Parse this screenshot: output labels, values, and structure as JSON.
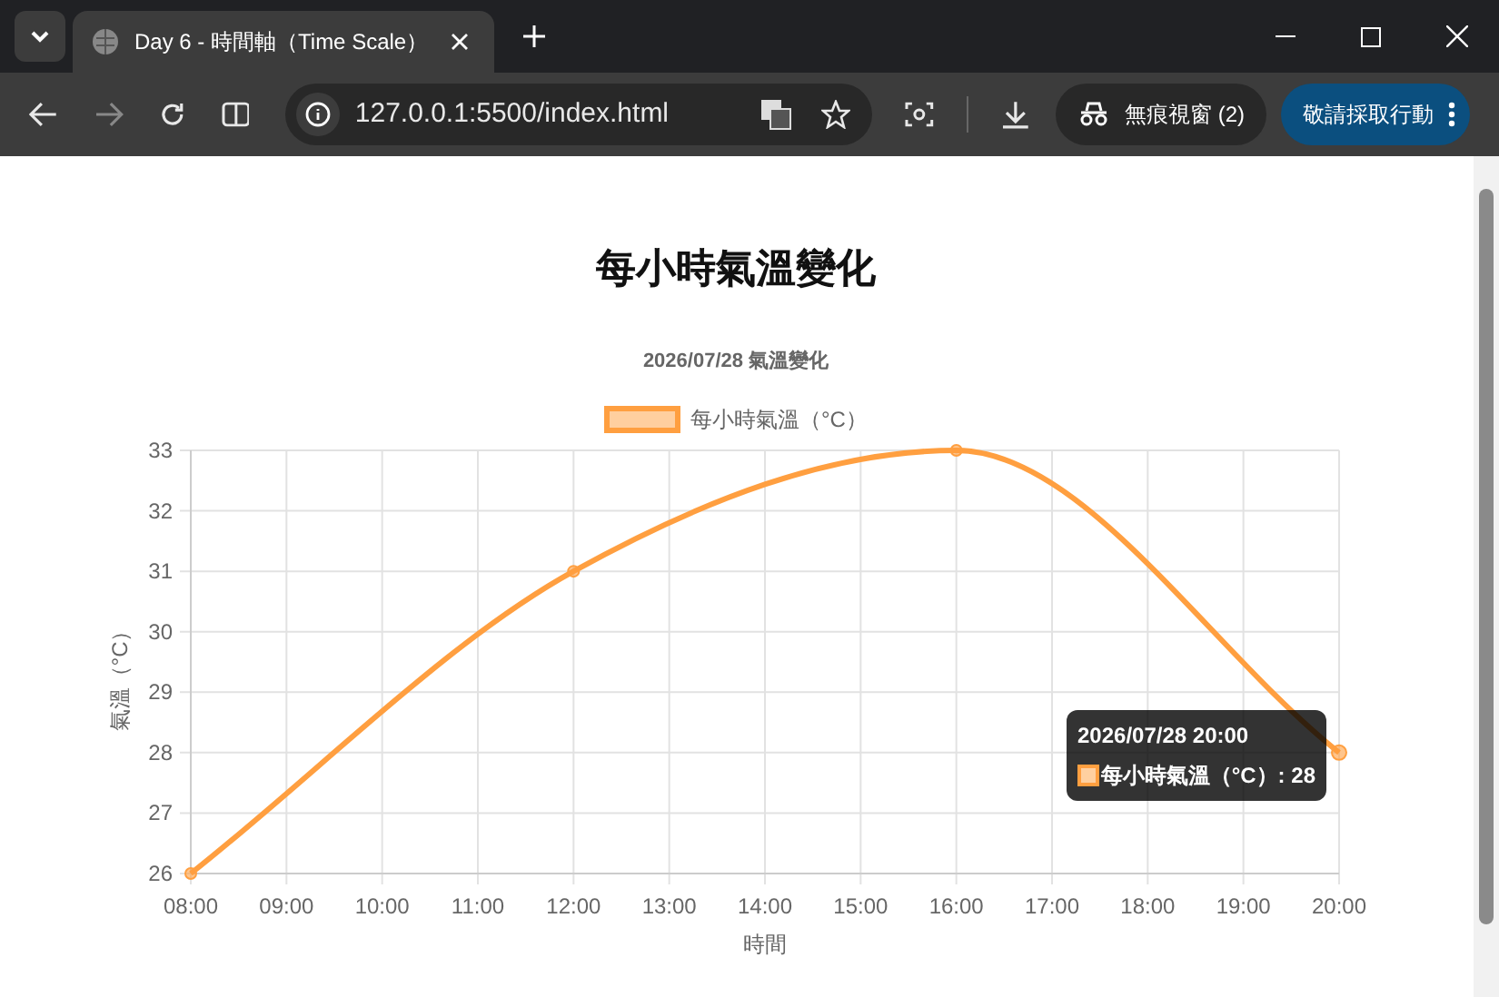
{
  "browser": {
    "tab": {
      "title": "Day 6 - 時間軸（Time Scale）",
      "selected": true
    },
    "address": "127.0.0.1:5500/index.html",
    "incognito": "無痕視窗 (2)",
    "action_button": "敬請採取行動"
  },
  "page": {
    "heading": "每小時氣溫變化",
    "chart": {
      "chart_data": {
        "type": "line",
        "title": "2026/07/28 氣溫變化",
        "xlabel": "時間",
        "ylabel": "氣溫（°C）",
        "x": [
          8,
          12,
          16,
          20
        ],
        "xlim": [
          8,
          20
        ],
        "ylim": [
          26,
          33
        ],
        "xticks": [
          {
            "value": 8,
            "label": "08:00"
          },
          {
            "value": 9,
            "label": "09:00"
          },
          {
            "value": 10,
            "label": "10:00"
          },
          {
            "value": 11,
            "label": "11:00"
          },
          {
            "value": 12,
            "label": "12:00"
          },
          {
            "value": 13,
            "label": "13:00"
          },
          {
            "value": 14,
            "label": "14:00"
          },
          {
            "value": 15,
            "label": "15:00"
          },
          {
            "value": 16,
            "label": "16:00"
          },
          {
            "value": 17,
            "label": "17:00"
          },
          {
            "value": 18,
            "label": "18:00"
          },
          {
            "value": 19,
            "label": "19:00"
          },
          {
            "value": 20,
            "label": "20:00"
          }
        ],
        "yticks": [
          26,
          27,
          28,
          29,
          30,
          31,
          32,
          33
        ],
        "grid": true,
        "series": [
          {
            "name": "每小時氣溫（°C）",
            "color": "#ff9f40",
            "marker": true,
            "values": [
              26,
              31,
              33,
              28
            ]
          }
        ]
      },
      "tooltip": {
        "title": "2026/07/28 20:00",
        "label": "每小時氣溫（°C）: 28"
      }
    }
  }
}
